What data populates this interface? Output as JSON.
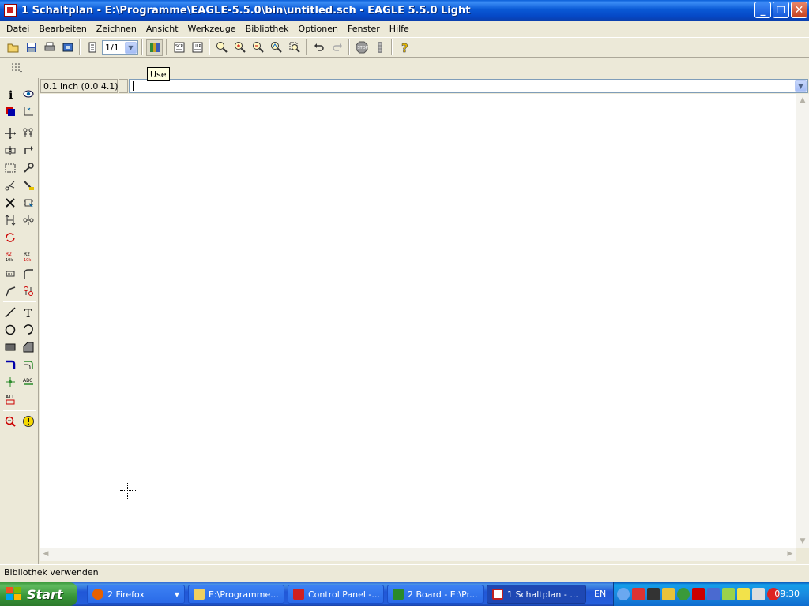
{
  "window": {
    "title": "1 Schaltplan - E:\\Programme\\EAGLE-5.5.0\\bin\\untitled.sch - EAGLE 5.5.0 Light",
    "minimize_label": "_",
    "maximize_label": "❐",
    "close_label": "✕"
  },
  "menu": [
    "Datei",
    "Bearbeiten",
    "Zeichnen",
    "Ansicht",
    "Werkzeuge",
    "Bibliothek",
    "Optionen",
    "Fenster",
    "Hilfe"
  ],
  "toolbar": {
    "sheet_select_value": "1/1",
    "tooltip": "Use"
  },
  "coordinate_display": "0.1 inch (0.0 4.1)",
  "command_line": {
    "value": ""
  },
  "status_text": "Bibliothek verwenden",
  "taskbar": {
    "start_label": "Start",
    "tasks": [
      {
        "label": "2 Firefox",
        "icon": "firefox-icon",
        "color": "#e66000"
      },
      {
        "label": "E:\\Programme...",
        "icon": "folder-icon",
        "color": "#f0d060"
      },
      {
        "label": "Control Panel -...",
        "icon": "control-panel-icon",
        "color": "#d02020"
      },
      {
        "label": "2 Board - E:\\Pr...",
        "icon": "board-icon",
        "color": "#2a8a2a"
      },
      {
        "label": "1 Schaltplan - ...",
        "icon": "schematic-icon",
        "color": "#c02020"
      }
    ],
    "language": "EN",
    "clock": "09:30"
  }
}
